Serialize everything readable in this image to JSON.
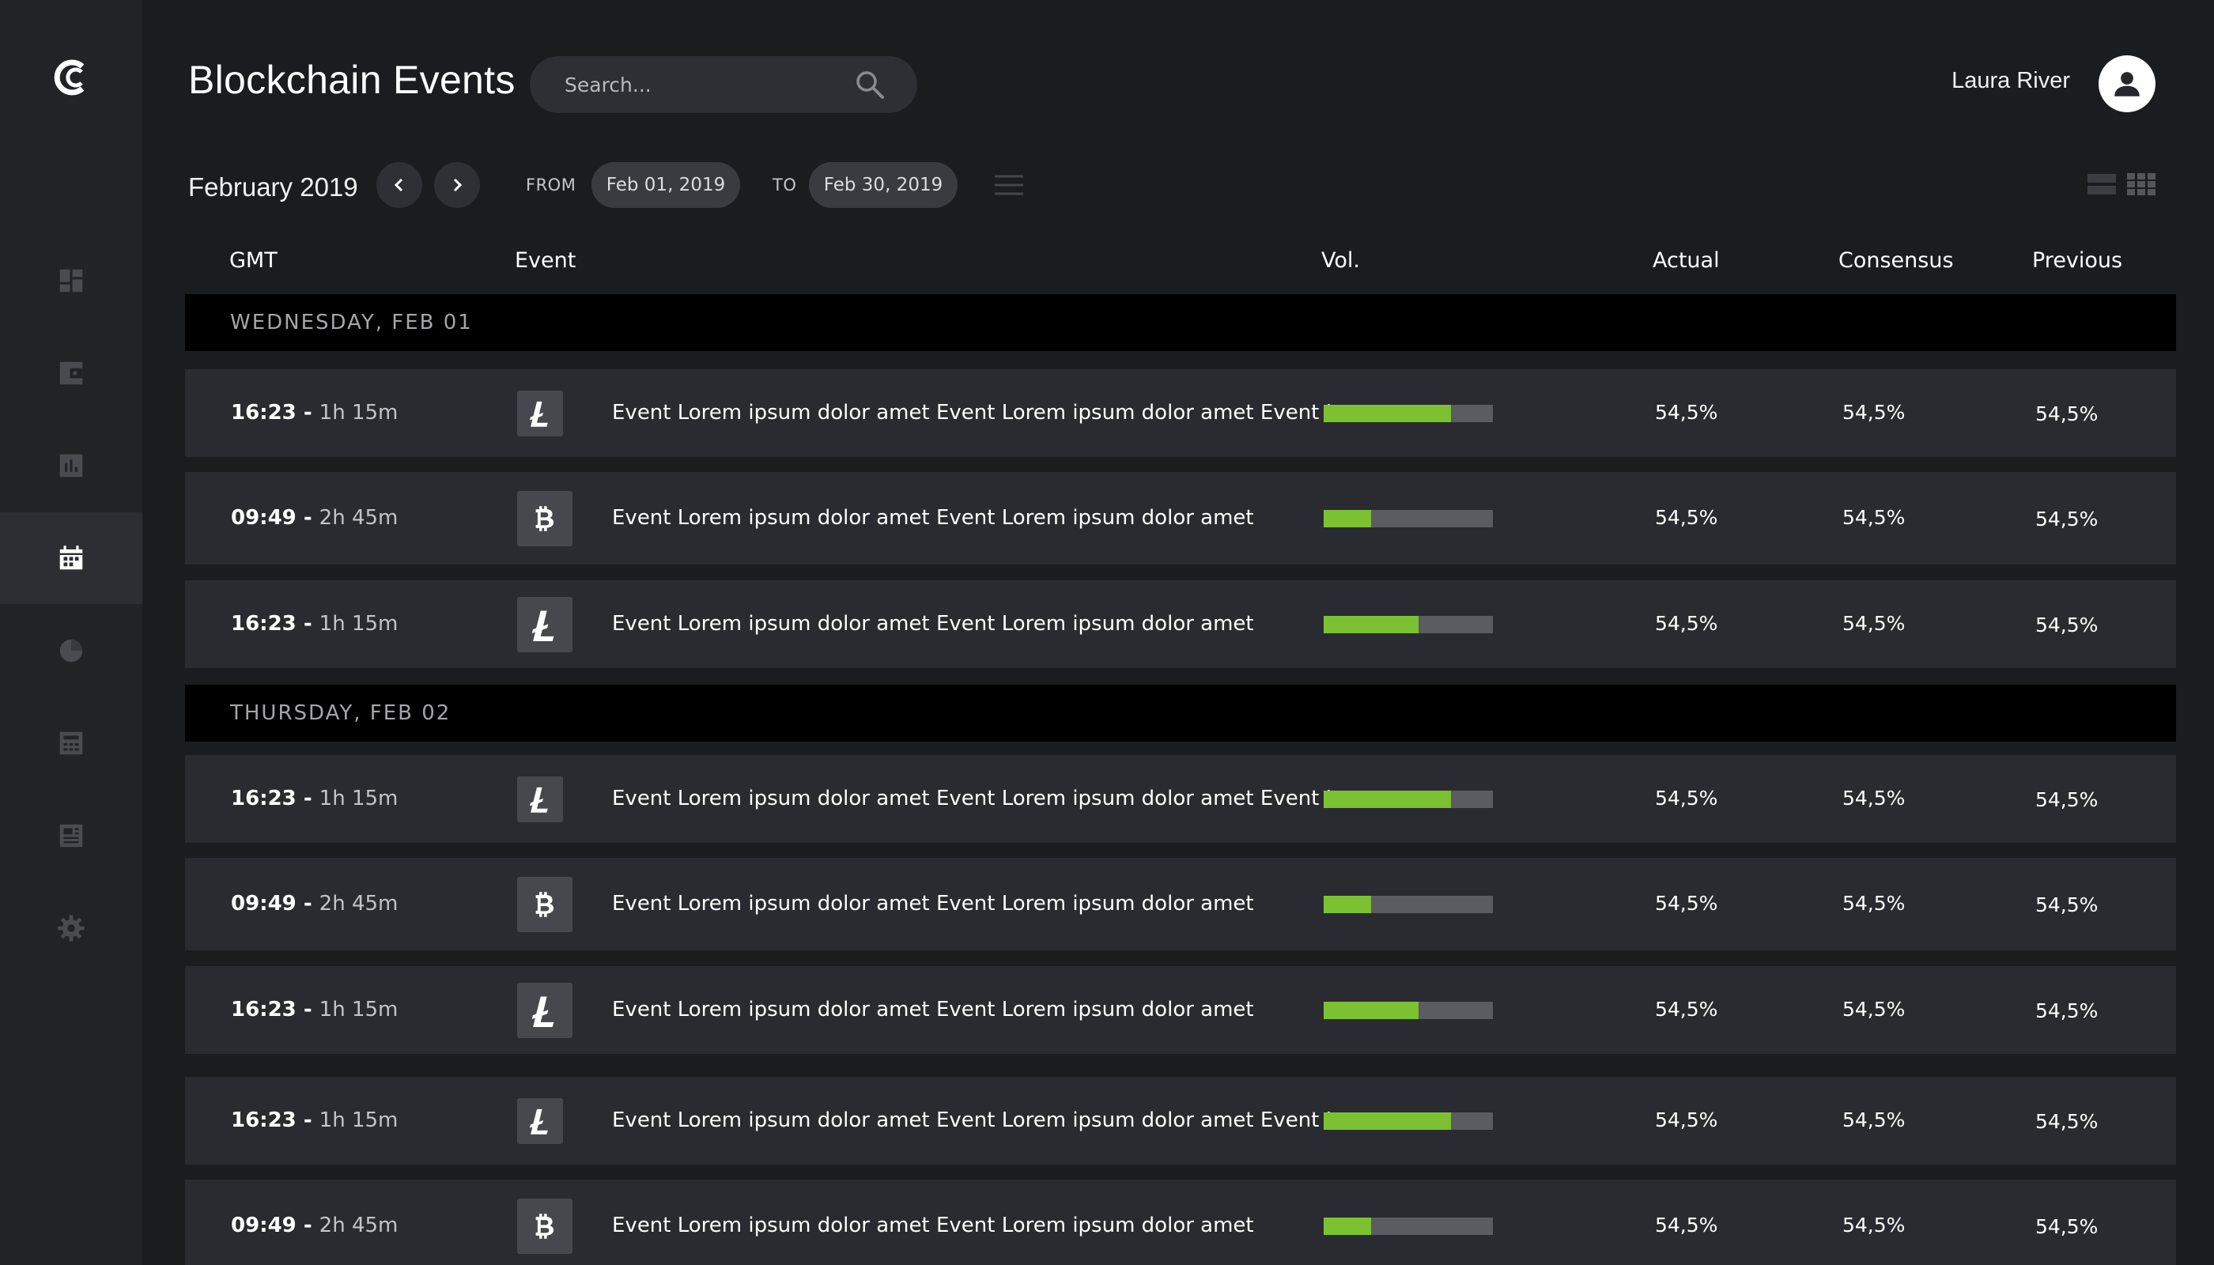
{
  "app": {
    "title": "Blockchain Events",
    "logo_icon": "cc-logo-icon"
  },
  "sidebar": {
    "items": [
      {
        "id": "dashboard",
        "icon": "dashboard-icon"
      },
      {
        "id": "wallet",
        "icon": "wallet-icon"
      },
      {
        "id": "charts",
        "icon": "bar-chart-icon"
      },
      {
        "id": "calendar",
        "icon": "calendar-icon",
        "active": true
      },
      {
        "id": "history",
        "icon": "pie-chart-icon"
      },
      {
        "id": "calculator",
        "icon": "calculator-icon"
      },
      {
        "id": "news",
        "icon": "news-icon"
      },
      {
        "id": "settings",
        "icon": "gear-icon"
      }
    ]
  },
  "header": {
    "search_placeholder": "Search...",
    "user_name": "Laura River"
  },
  "filters": {
    "month": "February 2019",
    "from_label": "FROM",
    "from_date": "Feb 01, 2019",
    "to_label": "TO",
    "to_date": "Feb 30, 2019"
  },
  "table": {
    "columns": {
      "gmt": "GMT",
      "event": "Event",
      "vol": "Vol.",
      "actual": "Actual",
      "consensus": "Consensus",
      "previous": "Previous"
    },
    "days": [
      {
        "label": "WEDNESDAY, FEB 01",
        "rows": [
          {
            "time": "16:23 -",
            "duration": "1h 15m",
            "coin": "litecoin-icon",
            "event": "Event Lorem ipsum dolor amet Event Lorem ipsum dolor amet Event Lorem ipsum dolor amet",
            "vol": 0.75,
            "actual": "54,5%",
            "consensus": "54,5%",
            "previous": "54,5%"
          },
          {
            "time": "09:49 -",
            "duration": "2h 45m",
            "coin": "bitcoin-icon",
            "event": "Event Lorem ipsum dolor amet Event Lorem ipsum dolor amet",
            "vol": 0.28,
            "actual": "54,5%",
            "consensus": "54,5%",
            "previous": "54,5%"
          },
          {
            "time": "16:23 -",
            "duration": "1h 15m",
            "coin": "litecoin-icon",
            "event": "Event Lorem ipsum dolor amet Event Lorem ipsum dolor amet",
            "vol": 0.56,
            "actual": "54,5%",
            "consensus": "54,5%",
            "previous": "54,5%"
          }
        ]
      },
      {
        "label": "THURSDAY, FEB 02",
        "rows": [
          {
            "time": "16:23 -",
            "duration": "1h 15m",
            "coin": "litecoin-icon",
            "event": "Event Lorem ipsum dolor amet Event Lorem ipsum dolor amet Event Lorem ipsum dolor amet",
            "vol": 0.75,
            "actual": "54,5%",
            "consensus": "54,5%",
            "previous": "54,5%"
          },
          {
            "time": "09:49 -",
            "duration": "2h 45m",
            "coin": "bitcoin-icon",
            "event": "Event Lorem ipsum dolor amet Event Lorem ipsum dolor amet",
            "vol": 0.28,
            "actual": "54,5%",
            "consensus": "54,5%",
            "previous": "54,5%"
          },
          {
            "time": "16:23 -",
            "duration": "1h 15m",
            "coin": "litecoin-icon",
            "event": "Event Lorem ipsum dolor amet Event Lorem ipsum dolor amet",
            "vol": 0.56,
            "actual": "54,5%",
            "consensus": "54,5%",
            "previous": "54,5%"
          },
          {
            "time": "16:23 -",
            "duration": "1h 15m",
            "coin": "litecoin-icon",
            "event": "Event Lorem ipsum dolor amet Event Lorem ipsum dolor amet Event Lorem ipsum dolor amet",
            "vol": 0.75,
            "actual": "54,5%",
            "consensus": "54,5%",
            "previous": "54,5%"
          },
          {
            "time": "09:49 -",
            "duration": "2h 45m",
            "coin": "bitcoin-icon",
            "event": "Event Lorem ipsum dolor amet Event Lorem ipsum dolor amet",
            "vol": 0.28,
            "actual": "54,5%",
            "consensus": "54,5%",
            "previous": "54,5%"
          }
        ]
      }
    ]
  },
  "colors": {
    "background": "#1b1c20",
    "sidebar": "#222327",
    "row": "#2a2b30",
    "day_header": "#000000",
    "vol_fill": "#7cc132",
    "vol_track": "#5b5c61"
  }
}
